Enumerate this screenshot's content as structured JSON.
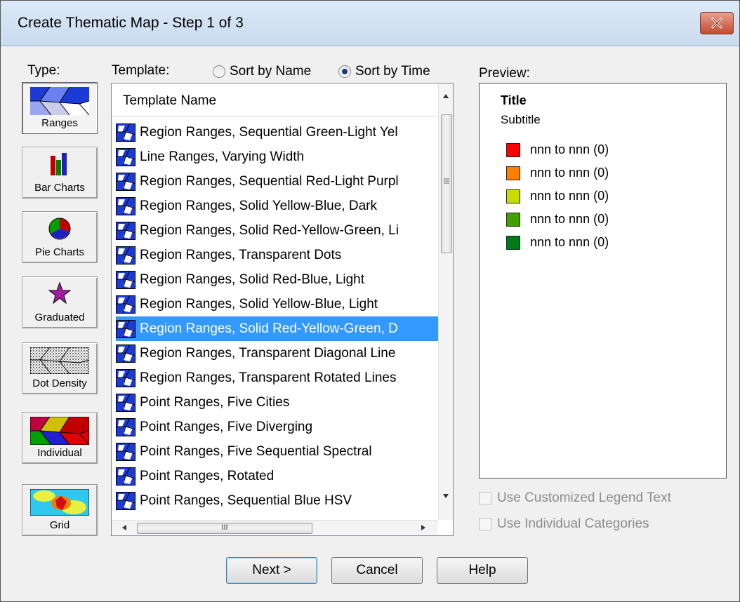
{
  "window": {
    "title": "Create Thematic Map - Step 1 of 3"
  },
  "type_panel": {
    "label": "Type:",
    "buttons": [
      {
        "label": "Ranges",
        "icon": "ranges-icon",
        "selected": true
      },
      {
        "label": "Bar Charts",
        "icon": "bar-chart-icon"
      },
      {
        "label": "Pie Charts",
        "icon": "pie-chart-icon"
      },
      {
        "label": "Graduated",
        "icon": "star-icon"
      },
      {
        "label": "Dot Density",
        "icon": "dot-density-icon"
      },
      {
        "label": "Individual",
        "icon": "individual-icon"
      },
      {
        "label": "Grid",
        "icon": "grid-icon"
      }
    ]
  },
  "template_panel": {
    "label": "Template:",
    "sort_by_name": "Sort by Name",
    "sort_by_time": "Sort by Time",
    "sort_selected": "time",
    "column_header": "Template Name",
    "rows": [
      "Region Ranges, Sequential Green-Light Yel",
      "Line Ranges, Varying Width",
      "Region Ranges, Sequential Red-Light Purpl",
      "Region Ranges, Solid Yellow-Blue, Dark",
      "Region Ranges, Solid Red-Yellow-Green, Li",
      "Region Ranges, Transparent Dots",
      "Region Ranges, Solid Red-Blue, Light",
      "Region Ranges, Solid Yellow-Blue, Light",
      "Region Ranges, Solid Red-Yellow-Green, D",
      "Region Ranges, Transparent Diagonal Line",
      "Region Ranges, Transparent Rotated Lines",
      "Point Ranges, Five Cities",
      "Point Ranges, Five Diverging",
      "Point Ranges, Five Sequential Spectral",
      "Point Ranges, Rotated",
      "Point Ranges, Sequential Blue HSV"
    ],
    "selected_index": 8,
    "hscroll_thumb_text": "III"
  },
  "preview": {
    "label": "Preview:",
    "title": "Title",
    "subtitle": "Subtitle",
    "legend": [
      {
        "text": "nnn to nnn  (0)",
        "color": "#ff0000"
      },
      {
        "text": "nnn to nnn  (0)",
        "color": "#ff8000"
      },
      {
        "text": "nnn to nnn  (0)",
        "color": "#c8dc00"
      },
      {
        "text": "nnn to nnn  (0)",
        "color": "#40a000"
      },
      {
        "text": "nnn to nnn  (0)",
        "color": "#007a14"
      }
    ],
    "use_custom_legend": "Use Customized Legend Text",
    "use_individual": "Use Individual Categories"
  },
  "buttons": {
    "next": "Next >",
    "cancel": "Cancel",
    "help": "Help"
  }
}
